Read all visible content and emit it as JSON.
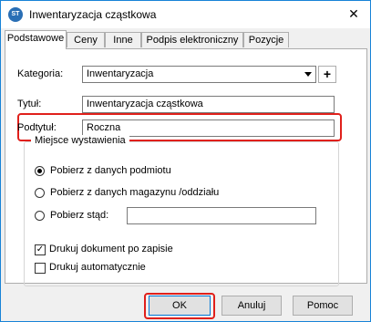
{
  "window": {
    "title": "Inwentaryzacja cząstkowa",
    "icon_text": "ST"
  },
  "tabs": [
    {
      "label": "Podstawowe"
    },
    {
      "label": "Ceny"
    },
    {
      "label": "Inne"
    },
    {
      "label": "Podpis elektroniczny"
    },
    {
      "label": "Pozycje"
    }
  ],
  "form": {
    "kategoria_label": "Kategoria:",
    "kategoria_value": "Inwentaryzacja",
    "add_button_label": "+",
    "tytul_label": "Tytuł:",
    "tytul_value": "Inwentaryzacja cząstkowa",
    "podtytul_label": "Podtytuł:",
    "podtytul_value": "Roczna"
  },
  "issue_place": {
    "legend": "Miejsce wystawienia",
    "options": [
      {
        "label": "Pobierz z danych podmiotu",
        "selected": true
      },
      {
        "label": "Pobierz z danych magazynu /oddziału",
        "selected": false
      },
      {
        "label": "Pobierz stąd:",
        "selected": false
      }
    ],
    "custom_value": ""
  },
  "checkboxes": [
    {
      "label": "Drukuj dokument po zapisie",
      "checked": true
    },
    {
      "label": "Drukuj automatycznie",
      "checked": false
    }
  ],
  "buttons": {
    "ok": "OK",
    "cancel": "Anuluj",
    "help": "Pomoc"
  },
  "colors": {
    "highlight": "#e0201b",
    "window_border": "#1883d7",
    "default_button_border": "#0078d7"
  }
}
